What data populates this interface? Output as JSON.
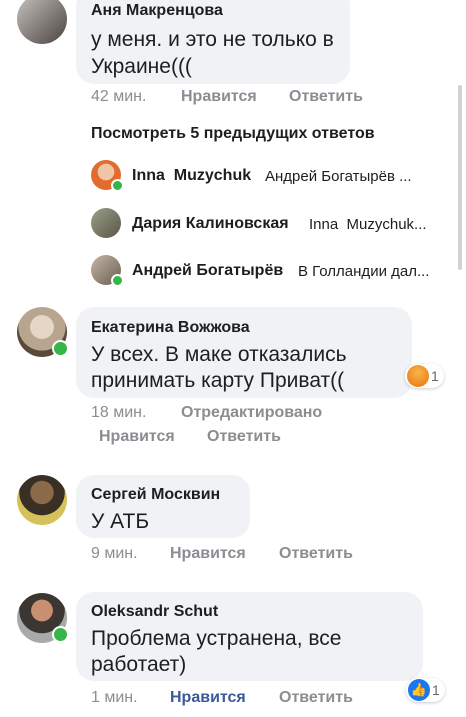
{
  "comments": [
    {
      "author": "Аня Макренцова",
      "line1": "у меня. и это не только в",
      "line2": "Украине(((",
      "time": "42 мин.",
      "like": "Нравится",
      "reply": "Ответить"
    },
    {
      "author": "Екатерина Вожжова",
      "line1": "У всех. В маке отказались",
      "line2": "принимать карту Приват((",
      "time": "18 мин.",
      "edited": "Отредактировано",
      "like": "Нравится",
      "reply": "Ответить",
      "reaction_count": "1",
      "reaction": "angry-emoji"
    },
    {
      "author": "Сергей Москвин",
      "line1": "У АТБ",
      "time": "9 мин.",
      "like": "Нравится",
      "reply": "Ответить"
    },
    {
      "author": "Oleksandr Schut",
      "line1": "Проблема устранена, все",
      "line2": "работает)",
      "time": "1 мин.",
      "like": "Нравится",
      "reply": "Ответить",
      "reaction_count": "1",
      "reaction": "like-icon",
      "like_color": "#3b5998"
    }
  ],
  "view_previous": "Посмотреть 5 предыдущих ответов",
  "replies": [
    {
      "name": "Inna  Muzychuk",
      "text": "Андрей Богатырёв ..."
    },
    {
      "name": "Дария Калиновская",
      "text": "Inna  Muzychuk..."
    },
    {
      "name": "Андрей Богатырёв",
      "text": "В Голландии дал..."
    }
  ],
  "colors": {
    "bubble": "#f0f2f5",
    "online": "#36b548",
    "meta": "#8a8d91",
    "liked": "#3b5998",
    "angry": "#e9710f"
  }
}
